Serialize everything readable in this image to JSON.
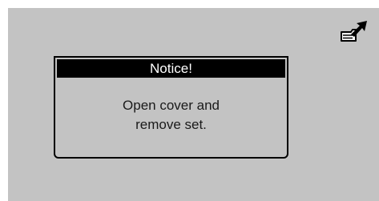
{
  "status": {
    "icon": "hand-pointing-up-icon"
  },
  "dialog": {
    "title": "Notice!",
    "message_lines": [
      "Open cover and",
      "remove set."
    ]
  },
  "colors": {
    "screen_background": "#c3c3c3",
    "title_bar": "#000000",
    "title_text": "#ffffff",
    "body_text": "#1a1a1a"
  }
}
